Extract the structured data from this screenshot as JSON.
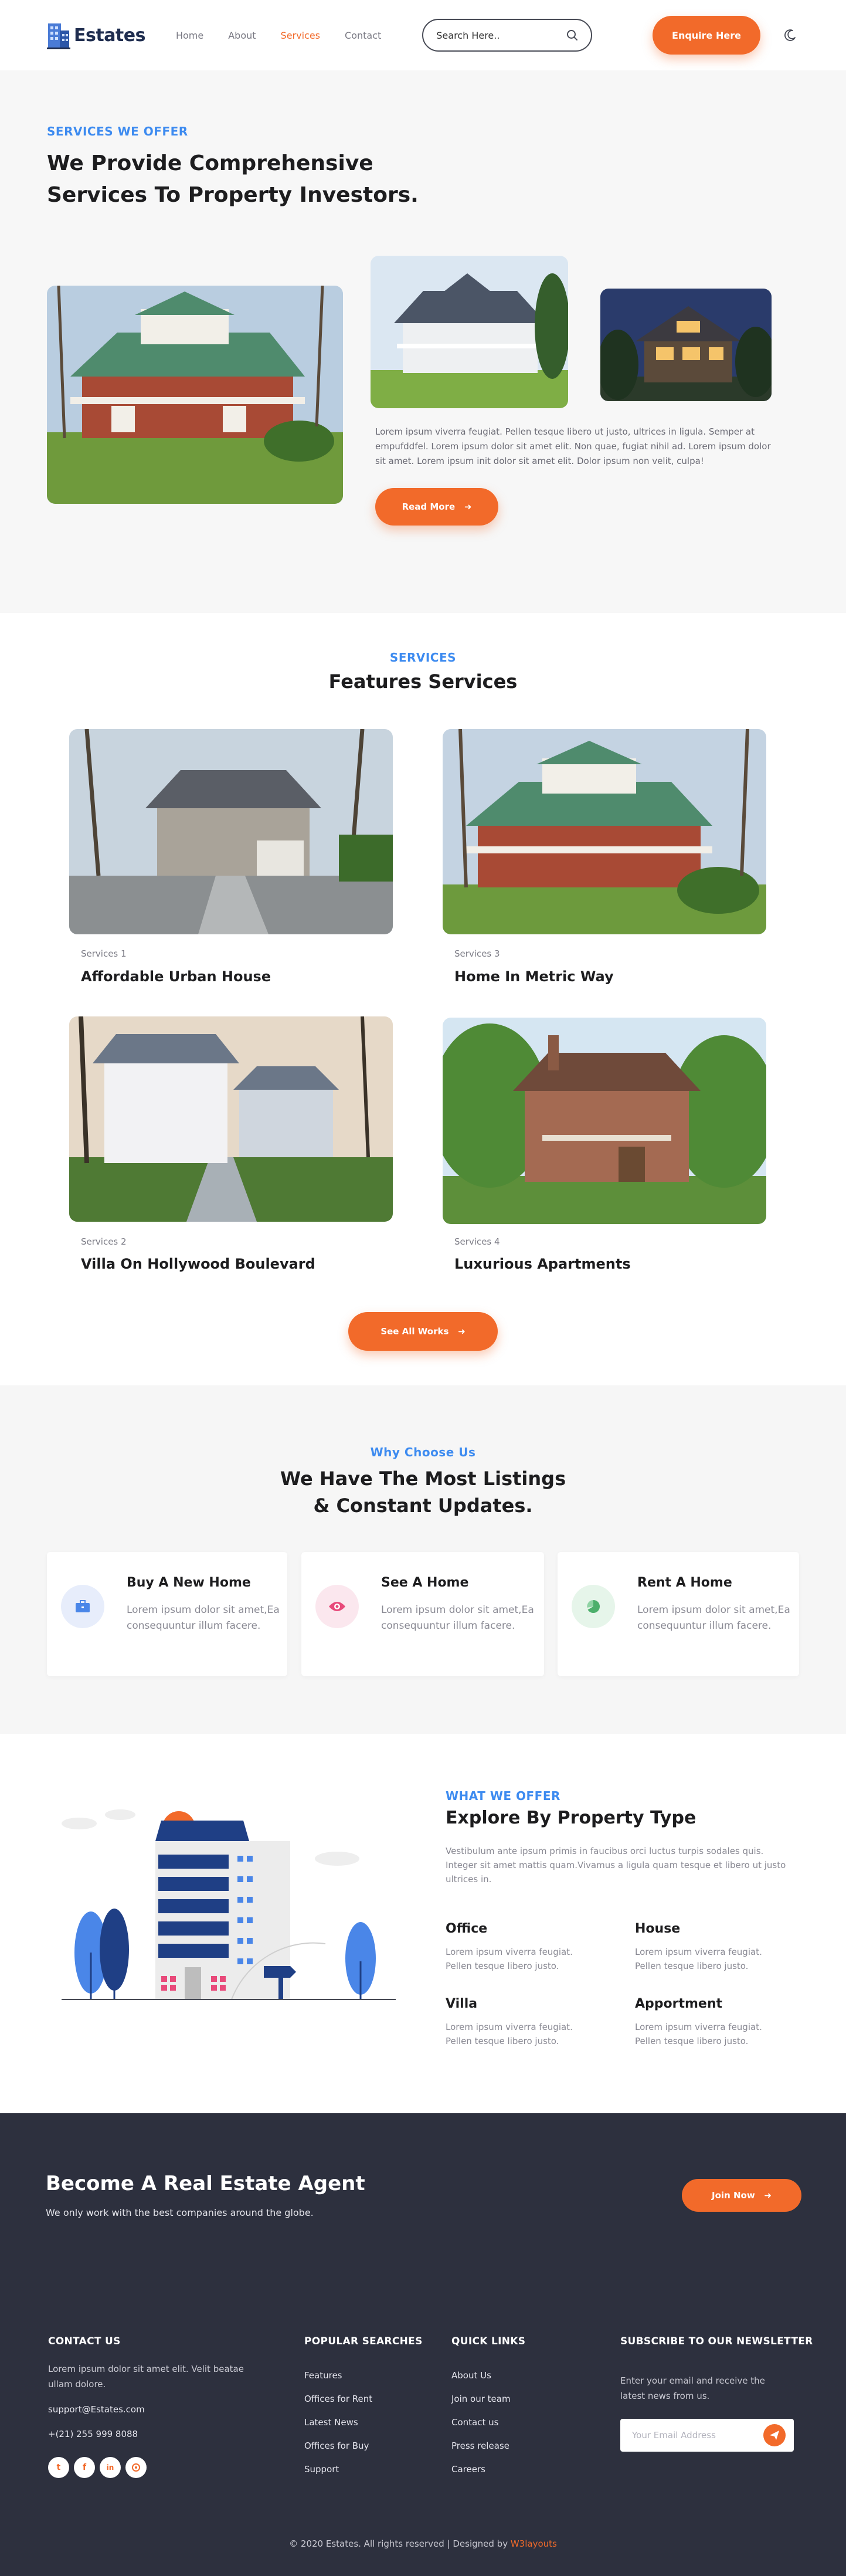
{
  "nav": {
    "logo_text": "Estates",
    "links": [
      "Home",
      "About",
      "Services",
      "Contact"
    ],
    "active_link": "Services",
    "search_placeholder": "Search Here..",
    "enquire_label": "Enquire Here"
  },
  "hero": {
    "eyebrow": "SERVICES WE OFFER",
    "title": "We Provide Comprehensive Services To Property Investors.",
    "text": "Lorem ipsum viverra feugiat. Pellen tesque libero ut justo, ultrices in ligula. Semper at empufddfel. Lorem ipsum dolor sit amet elit. Non quae, fugiat nihil ad. Lorem ipsum dolor sit amet. Lorem ipsum init dolor sit amet elit. Dolor ipsum non velit, culpa!",
    "read_more_label": "Read More"
  },
  "features": {
    "eyebrow": "SERVICES",
    "title": "Features Services",
    "cards": [
      {
        "sub": "Services 1",
        "title": "Affordable Urban House"
      },
      {
        "sub": "Services 3",
        "title": "Home In Metric Way"
      },
      {
        "sub": "Services 2",
        "title": "Villa On Hollywood Boulevard"
      },
      {
        "sub": "Services 4",
        "title": "Luxurious Apartments"
      }
    ],
    "see_all_label": "See All  Works"
  },
  "why": {
    "eyebrow": "Why Choose Us",
    "title_line1": "We Have The Most Listings",
    "title_line2": "& Constant Updates.",
    "cards": [
      {
        "title": "Buy A New Home",
        "text": "Lorem ipsum dolor sit amet,Ea consequuntur illum facere.",
        "icon": "briefcase-icon",
        "icon_color": "#4a86e8",
        "bg": "#e7edfb"
      },
      {
        "title": "See A Home",
        "text": "Lorem ipsum dolor sit amet,Ea consequuntur illum facere.",
        "icon": "eye-icon",
        "icon_color": "#e84a7a",
        "bg": "#fbe7ee"
      },
      {
        "title": "Rent A Home",
        "text": "Lorem ipsum dolor sit amet,Ea consequuntur illum facere.",
        "icon": "pie-chart-icon",
        "icon_color": "#4caf6b",
        "bg": "#e6f5ea"
      }
    ]
  },
  "property": {
    "eyebrow": "WHAT WE OFFER",
    "title": "Explore By Property Type",
    "description": "Vestibulum ante ipsum primis in faucibus orci luctus turpis sodales quis. Integer sit amet mattis quam.Vivamus a ligula quam tesque et libero ut justo ultrices in.",
    "types": [
      {
        "title": "Office",
        "text": "Lorem ipsum viverra feugiat. Pellen tesque libero justo."
      },
      {
        "title": "House",
        "text": "Lorem ipsum viverra feugiat. Pellen tesque libero justo."
      },
      {
        "title": "Villa",
        "text": "Lorem ipsum viverra feugiat. Pellen tesque libero justo."
      },
      {
        "title": "Apportment",
        "text": "Lorem ipsum viverra feugiat. Pellen tesque libero justo."
      }
    ]
  },
  "agent": {
    "title": "Become A Real Estate Agent",
    "subtitle": "We only work with the best companies around the globe.",
    "join_label": "Join Now"
  },
  "footer": {
    "contact": {
      "heading": "CONTACT US",
      "text": "Lorem ipsum dolor sit amet elit. Velit beatae ullam dolore.",
      "email": "support@Estates.com",
      "phone": "+(21) 255 999 8088",
      "social": [
        "twitter-icon",
        "facebook-icon",
        "linkedin-icon",
        "github-icon"
      ]
    },
    "popular": {
      "heading": "POPULAR SEARCHES",
      "links": [
        "Features",
        "Offices for Rent",
        "Latest News",
        "Offices for Buy",
        "Support"
      ]
    },
    "quick": {
      "heading": "QUICK LINKS",
      "links": [
        "About Us",
        "Join our team",
        "Contact us",
        "Press release",
        "Careers"
      ]
    },
    "newsletter": {
      "heading": "SUBSCRIBE TO OUR NEWSLETTER",
      "text": "Enter your email and receive the latest news from us.",
      "placeholder": "Your Email Address"
    },
    "copyright_prefix": "© 2020 Estates. All rights reserved | Designed by ",
    "copyright_brand": "W3layouts"
  },
  "colors": {
    "accent": "#f26a2a",
    "eyebrow_blue": "#3d8bf0",
    "footer_bg": "#2d303e"
  }
}
